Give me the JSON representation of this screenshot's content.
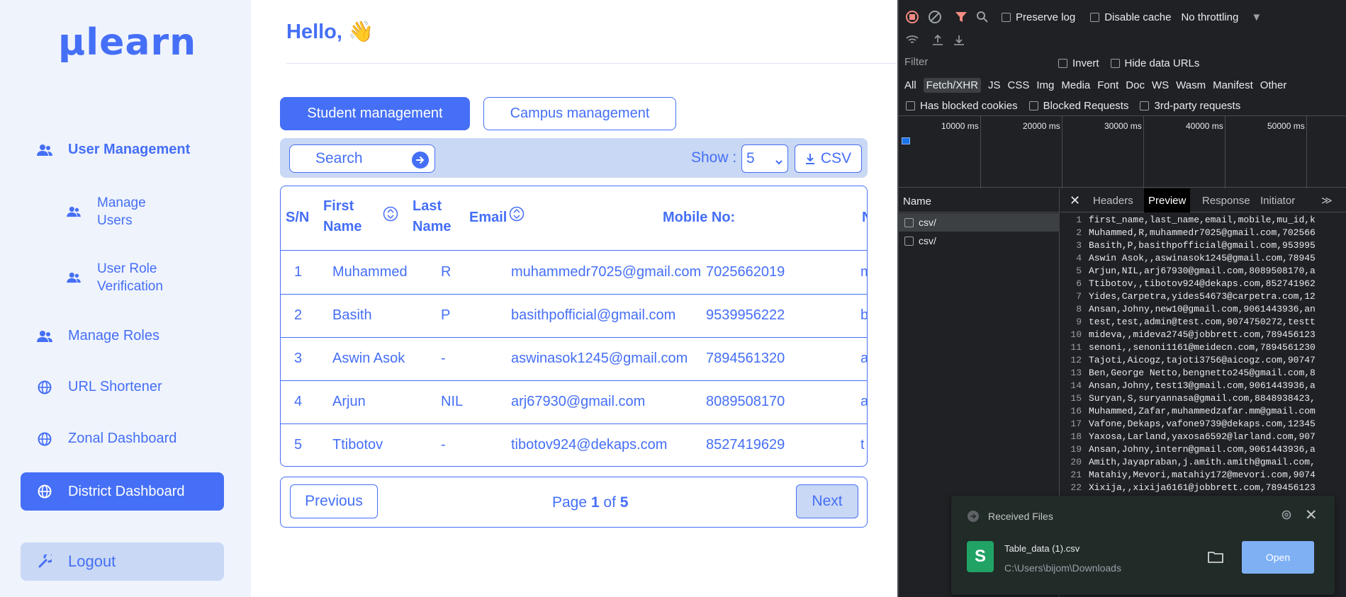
{
  "sidebar": {
    "logo": "µlearn",
    "items": [
      {
        "label": "User Management"
      },
      {
        "label": "Manage Users"
      },
      {
        "label": "User Role Verification"
      },
      {
        "label": "Manage Roles"
      },
      {
        "label": "URL Shortener"
      },
      {
        "label": "Zonal Dashboard"
      },
      {
        "label": "District Dashboard"
      }
    ],
    "logout": "Logout"
  },
  "main": {
    "greeting": "Hello, 👋",
    "tabs": [
      "Student management",
      "Campus management"
    ],
    "search_placeholder": "Search",
    "show_label": "Show :",
    "show_value": "5",
    "csv_label": "CSV",
    "columns": [
      "S/N",
      "First Name",
      "Last Name",
      "Email",
      "Mobile No:",
      "N"
    ],
    "rows": [
      {
        "sn": "1",
        "first": "Muhammed",
        "last": "R",
        "email": "muhammedr7025@gmail.com",
        "mobile": "7025662019",
        "extra": "m"
      },
      {
        "sn": "2",
        "first": "Basith",
        "last": "P",
        "email": "basithpofficial@gmail.com",
        "mobile": "9539956222",
        "extra": "b"
      },
      {
        "sn": "3",
        "first": "Aswin Asok",
        "last": "-",
        "email": "aswinasok1245@gmail.com",
        "mobile": "7894561320",
        "extra": "a"
      },
      {
        "sn": "4",
        "first": "Arjun",
        "last": "NIL",
        "email": "arj67930@gmail.com",
        "mobile": "8089508170",
        "extra": "a"
      },
      {
        "sn": "5",
        "first": "Ttibotov",
        "last": "-",
        "email": "tibotov924@dekaps.com",
        "mobile": "8527419629",
        "extra": "t"
      }
    ],
    "pager": {
      "prev": "Previous",
      "next": "Next",
      "page_word": "Page",
      "current": "1",
      "of_word": "of",
      "total": "5"
    }
  },
  "devtools": {
    "preserve_log": "Preserve log",
    "disable_cache": "Disable cache",
    "throttling": "No throttling",
    "filter_placeholder": "Filter",
    "invert": "Invert",
    "hide_data_urls": "Hide data URLs",
    "types": [
      "All",
      "Fetch/XHR",
      "JS",
      "CSS",
      "Img",
      "Media",
      "Font",
      "Doc",
      "WS",
      "Wasm",
      "Manifest",
      "Other"
    ],
    "has_blocked_cookies": "Has blocked cookies",
    "blocked_requests": "Blocked Requests",
    "third_party": "3rd-party requests",
    "ticks": [
      "10000 ms",
      "20000 ms",
      "30000 ms",
      "40000 ms",
      "50000 ms"
    ],
    "name_header": "Name",
    "requests": [
      "csv/",
      "csv/"
    ],
    "panel_tabs": [
      "Headers",
      "Preview",
      "Response",
      "Initiator"
    ],
    "preview_lines": [
      "first_name,last_name,email,mobile,mu_id,k",
      "Muhammed,R,muhammedr7025@gmail.com,702566",
      "Basith,P,basithpofficial@gmail.com,953995",
      "Aswin Asok,,aswinasok1245@gmail.com,78945",
      "Arjun,NIL,arj67930@gmail.com,8089508170,a",
      "Ttibotov,,tibotov924@dekaps.com,852741962",
      "Yides,Carpetra,yides54673@carpetra.com,12",
      "Ansan,Johny,new10@gmail.com,9061443936,an",
      "test,test,admin@test.com,9074750272,testt",
      "mideva,,mideva2745@jobbrett.com,789456123",
      "senoni,,senoni1161@meidecn.com,7894561230",
      "Tajoti,Aicogz,tajoti3756@aicogz.com,90747",
      "Ben,George Netto,bengnetto245@gmail.com,8",
      "Ansan,Johny,test13@gmail.com,9061443936,a",
      "Suryan,S,suryannasa@gmail.com,8848938423,",
      "Muhammed,Zafar,muhammedzafar.mm@gmail.com",
      "Vafone,Dekaps,vafone9739@dekaps.com,12345",
      "Yaxosa,Larland,yaxosa6592@larland.com,907",
      "Ansan,Johny,intern@gmail.com,9061443936,a",
      "Amith,Jayapraban,j.amith.amith@gmail.com,",
      "Matahiy,Mevori,matahiy172@mevori.com,9074",
      "Xixija,,xixija6161@jobbrett.com,789456123"
    ]
  },
  "toast": {
    "title": "Received Files",
    "file_name": "Table_data (1).csv",
    "path": "C:\\Users\\bijom\\Downloads",
    "open": "Open"
  }
}
